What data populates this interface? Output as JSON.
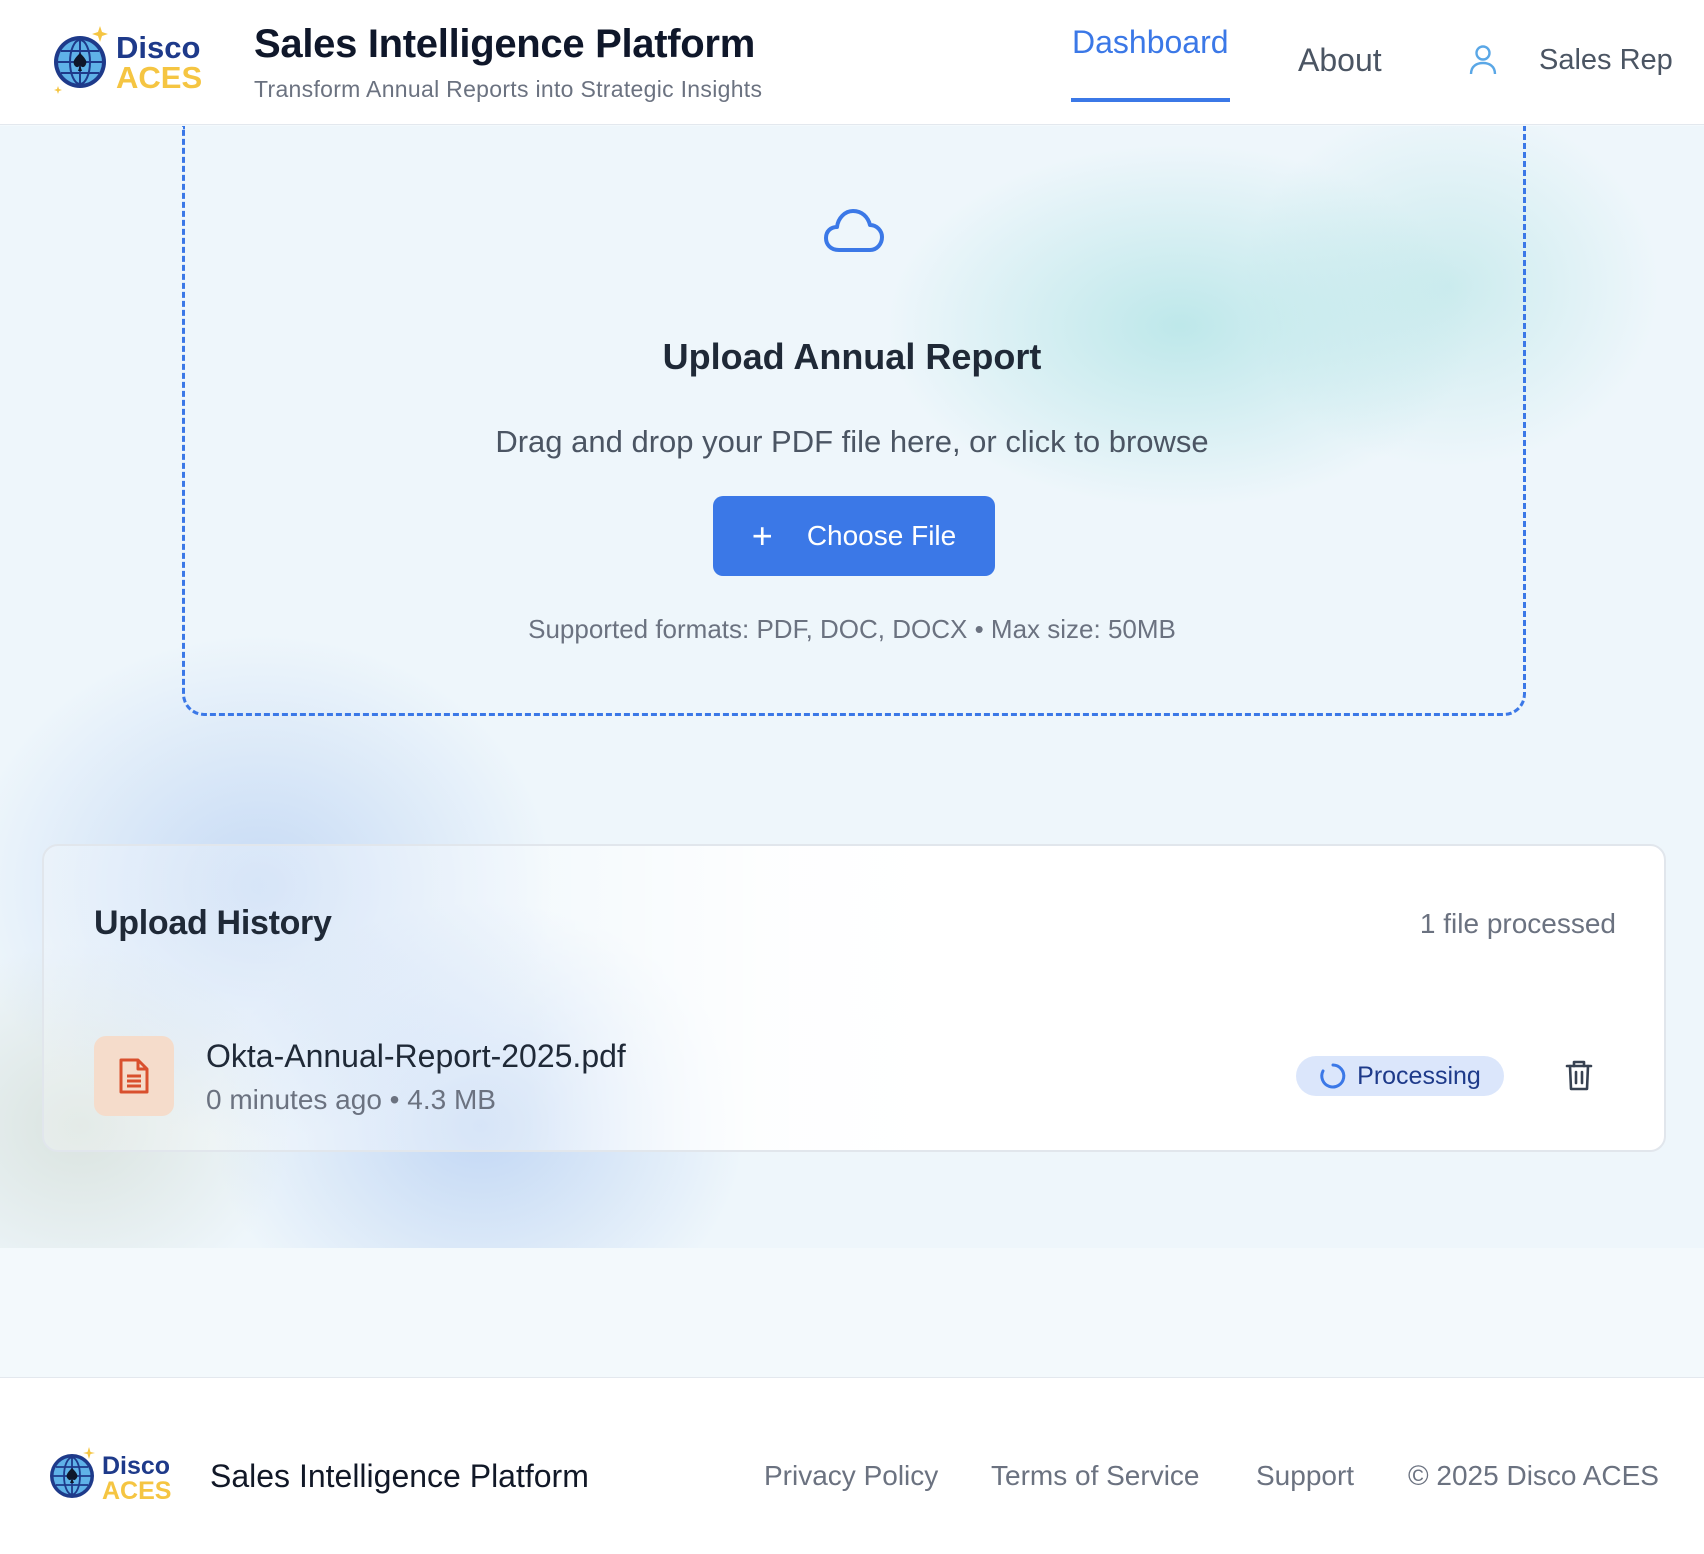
{
  "header": {
    "logo_line1": "Disco",
    "logo_line2": "ACES",
    "title": "Sales Intelligence Platform",
    "subtitle": "Transform Annual Reports into Strategic Insights",
    "nav": [
      {
        "label": "Dashboard",
        "active": true
      },
      {
        "label": "About",
        "active": false
      }
    ],
    "user_label": "Sales Rep",
    "user_icon": "user-icon"
  },
  "upload": {
    "icon": "cloud-icon",
    "title": "Upload Annual Report",
    "description": "Drag and drop your PDF file here, or click to browse",
    "button_icon": "+",
    "button_label": "Choose File",
    "supported": "Supported formats: PDF, DOC, DOCX • Max size: 50MB"
  },
  "history": {
    "title": "Upload History",
    "count_text": "1 file processed",
    "files": [
      {
        "name": "Okta-Annual-Report-2025.pdf",
        "meta": "0 minutes ago • 4.3 MB",
        "status": "Processing",
        "icon": "document-icon"
      }
    ]
  },
  "footer": {
    "logo_line1": "Disco",
    "logo_line2": "ACES",
    "title": "Sales Intelligence Platform",
    "links": [
      "Privacy Policy",
      "Terms of Service",
      "Support"
    ],
    "copyright": "© 2025 Disco ACES"
  },
  "colors": {
    "accent": "#3b78e7",
    "logo_navy": "#1e3a8a",
    "logo_gold": "#f5c542",
    "file_icon_bg": "#f5dccb",
    "file_icon": "#d9502e",
    "badge_bg": "#dbe6fb"
  }
}
